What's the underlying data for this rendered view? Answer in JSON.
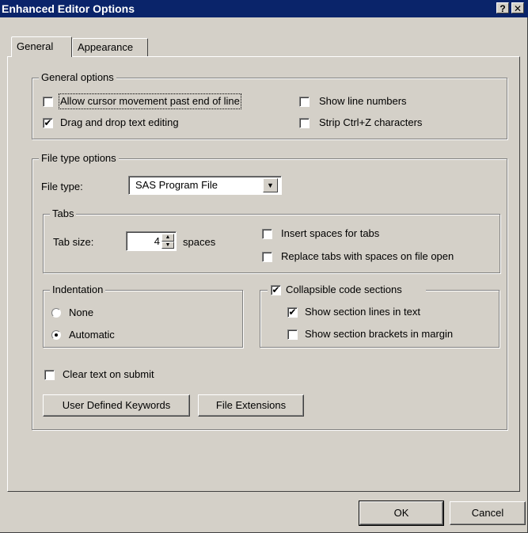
{
  "window": {
    "title": "Enhanced Editor Options",
    "help_glyph": "?",
    "close_glyph": "✕"
  },
  "tabs": [
    {
      "label": "General",
      "active": true
    },
    {
      "label": "Appearance",
      "active": false
    }
  ],
  "general_options": {
    "legend": "General options",
    "allow_cursor": {
      "label": "Allow cursor movement past end of line",
      "checked": false
    },
    "show_line_numbers": {
      "label": "Show line numbers",
      "checked": false
    },
    "drag_drop": {
      "label": "Drag and drop text editing",
      "checked": true
    },
    "strip_ctrlz": {
      "label": "Strip Ctrl+Z characters",
      "checked": false
    }
  },
  "file_type_options": {
    "legend": "File type options",
    "file_type_label": "File type:",
    "file_type_value": "SAS Program File",
    "tabs_group": {
      "legend": "Tabs",
      "tab_size_label": "Tab size:",
      "tab_size_value": "4",
      "spaces_label": "spaces",
      "insert_spaces": {
        "label": "Insert spaces for tabs",
        "checked": false
      },
      "replace_tabs": {
        "label": "Replace tabs with spaces on file open",
        "checked": false
      }
    },
    "indentation": {
      "legend": "Indentation",
      "none": {
        "label": "None",
        "selected": false
      },
      "automatic": {
        "label": "Automatic",
        "selected": true
      }
    },
    "collapsible": {
      "label": "Collapsible code sections",
      "checked": true,
      "show_section_lines": {
        "label": "Show section lines in text",
        "checked": true
      },
      "show_section_brackets": {
        "label": "Show section brackets in margin",
        "checked": false
      }
    },
    "clear_text": {
      "label": "Clear text on submit",
      "checked": false
    },
    "user_keywords_button": "User Defined Keywords",
    "file_extensions_button": "File Extensions"
  },
  "footer": {
    "ok_label": "OK",
    "cancel_label": "Cancel"
  },
  "glyphs": {
    "check": "✔",
    "dropdown": "▼",
    "spin_up": "▲",
    "spin_down": "▼"
  }
}
